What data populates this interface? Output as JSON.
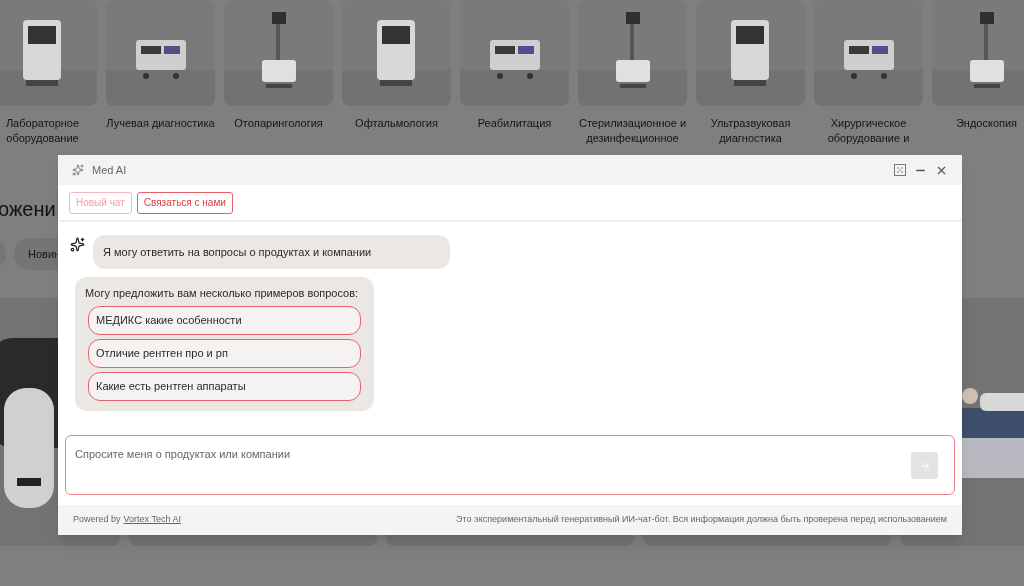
{
  "categories": [
    {
      "label": "Лабораторное оборудование"
    },
    {
      "label": "Лучевая диагностика"
    },
    {
      "label": "Отоларингология"
    },
    {
      "label": "Офтальмология"
    },
    {
      "label": "Реабилитация"
    },
    {
      "label": "Стерилизационное и дезинфекционное"
    },
    {
      "label": "Ультразвуковая диагностика"
    },
    {
      "label": "Хирургическое оборудование и"
    },
    {
      "label": "Эндоскопия"
    }
  ],
  "section_heading": "ожени",
  "filter_chips": [
    {
      "kind": "blank"
    },
    {
      "kind": "text",
      "label": "Новин"
    }
  ],
  "chat": {
    "title": "Med AI",
    "toolbar_buttons": [
      {
        "label": "Новый чат",
        "disabled": true
      },
      {
        "label": "Связаться с нами",
        "disabled": false
      }
    ],
    "messages": [
      {
        "kind": "bot",
        "text": "Я могу ответить на вопросы о продуктах и компании"
      },
      {
        "kind": "suggestions",
        "text": "Могу предложить вам несколько примеров вопросов:",
        "suggestions": [
          "МЕДИКС какие особенности",
          "Отличие рентген про и рп",
          "Какие есть рентген аппараты"
        ]
      }
    ],
    "input": {
      "placeholder": "Спросите меня о продуктах или компании"
    },
    "send_disabled": true,
    "footer": {
      "powered_by": "Powered by",
      "link": "Vortex Tech AI",
      "disclaimer": "Это экспериментальный генеративный ИИ-чат-бот. Вся информация должна быть проверена перед использованием"
    }
  }
}
